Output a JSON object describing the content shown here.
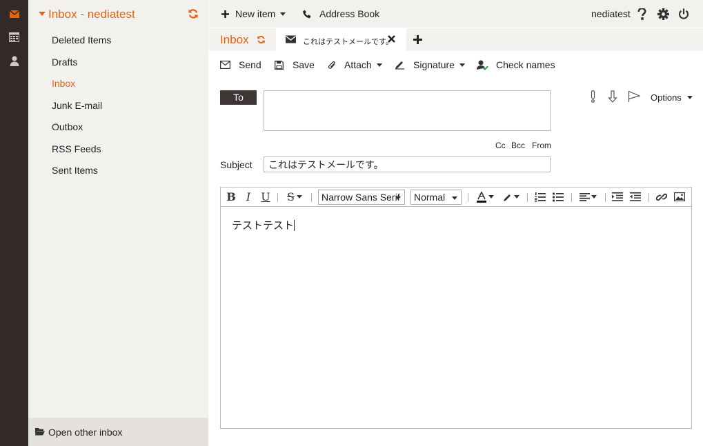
{
  "rail": {
    "items": [
      "mail-icon",
      "calendar-icon",
      "contacts-icon"
    ]
  },
  "folders": {
    "title": "Inbox - nediatest",
    "items": [
      {
        "label": "Deleted Items",
        "active": false
      },
      {
        "label": "Drafts",
        "active": false
      },
      {
        "label": "Inbox",
        "active": true
      },
      {
        "label": "Junk E-mail",
        "active": false
      },
      {
        "label": "Outbox",
        "active": false
      },
      {
        "label": "RSS Feeds",
        "active": false
      },
      {
        "label": "Sent Items",
        "active": false
      }
    ],
    "open_other": "Open other inbox"
  },
  "topbar": {
    "new_item": "New item",
    "address_book": "Address Book",
    "username": "nediatest"
  },
  "tabs": {
    "inbox": "Inbox",
    "mail": "これはテストメールです。"
  },
  "actions": {
    "send": "Send",
    "save": "Save",
    "attach": "Attach",
    "signature": "Signature",
    "check_names": "Check names"
  },
  "compose": {
    "to_label": "To",
    "to_value": "",
    "cc": "Cc",
    "bcc": "Bcc",
    "from": "From",
    "subject_label": "Subject",
    "subject_value": "これはテストメールです。",
    "options": "Options",
    "font_family": "Narrow Sans Serif",
    "font_size": "Normal",
    "body": "テストテスト"
  },
  "colors": {
    "accent": "#e8620c",
    "rail": "#332a28",
    "panel": "#f3f1ee"
  }
}
